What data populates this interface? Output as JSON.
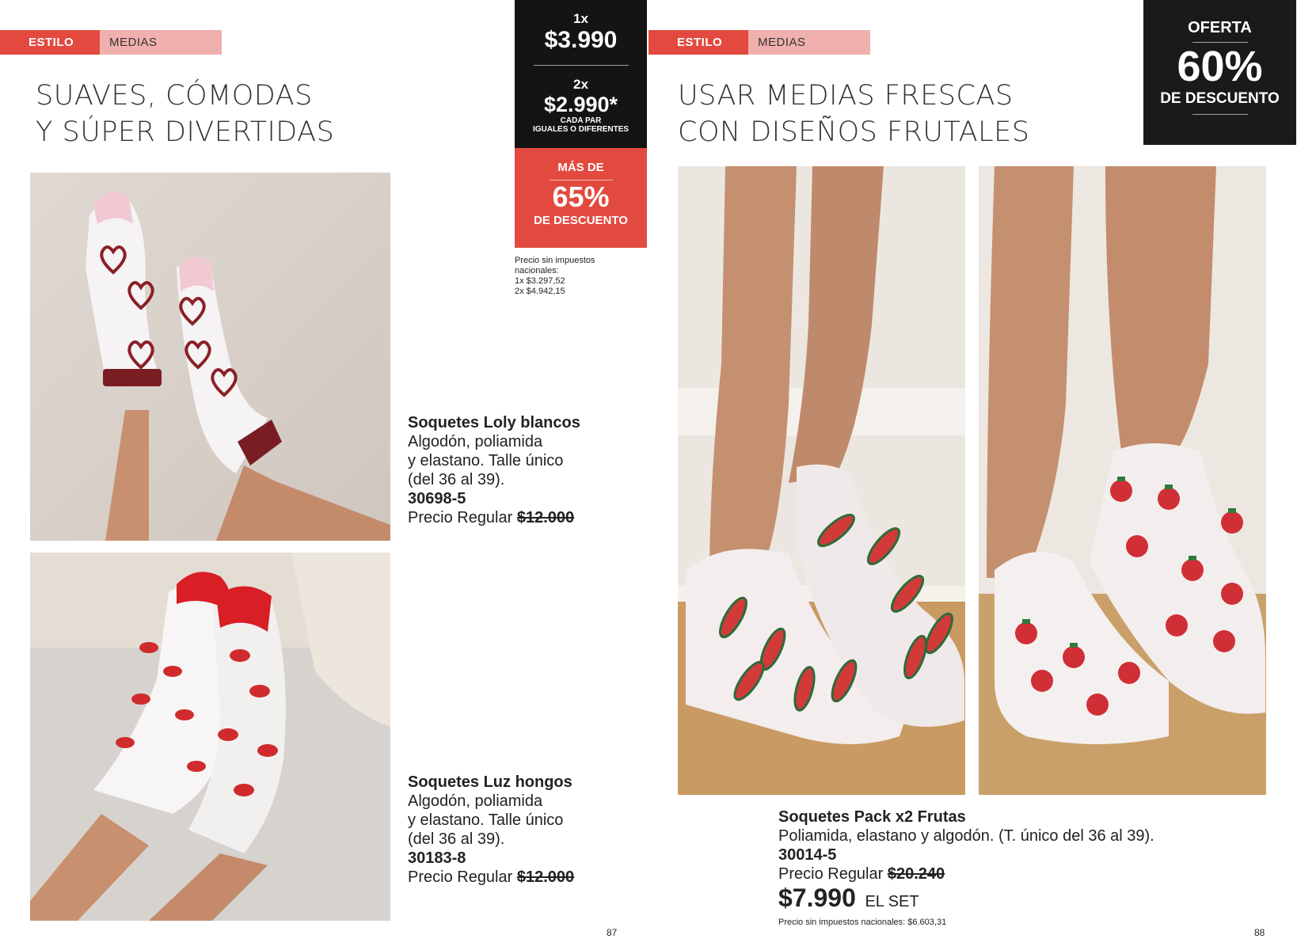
{
  "left_page": {
    "tag": {
      "section": "ESTILO",
      "category": "MEDIAS"
    },
    "headline": [
      "SUAVES, CÓMODAS",
      "Y SÚPER DIVERTIDAS"
    ],
    "products": [
      {
        "name": "Soquetes Loly blancos",
        "desc_lines": [
          "Algodón, poliamida",
          "y elastano. Talle único",
          "(del 36 al 39)."
        ],
        "code": "30698-5",
        "regular_label": "Precio Regular",
        "regular_price": "$12.000"
      },
      {
        "name": "Soquetes Luz hongos",
        "desc_lines": [
          "Algodón, poliamida",
          "y elastano. Talle único",
          "(del 36 al 39)."
        ],
        "code": "30183-8",
        "regular_label": "Precio Regular",
        "regular_price": "$12.000"
      }
    ],
    "page_number": "87"
  },
  "pricebox": {
    "one_qty": "1x",
    "one_price": "$3.990",
    "two_qty": "2x",
    "two_price": "$2.990*",
    "two_note_1": "CADA PAR",
    "two_note_2": "IGUALES O DIFERENTES",
    "discount_prefix": "MÁS DE",
    "discount_value": "65%",
    "discount_suffix": "DE DESCUENTO",
    "tax_note": [
      "Precio sin impuestos",
      "nacionales:",
      "1x $3.297,52",
      "2x $4.942,15"
    ]
  },
  "right_page": {
    "tag": {
      "section": "ESTILO",
      "category": "MEDIAS"
    },
    "headline": [
      "USAR MEDIAS FRESCAS",
      "CON DISEÑOS FRUTALES"
    ],
    "offer": {
      "label": "OFERTA",
      "value": "60%",
      "suffix": "DE DESCUENTO"
    },
    "product": {
      "name": "Soquetes Pack x2 Frutas",
      "desc": "Poliamida, elastano y algodón. (T. único del 36 al 39).",
      "code": "30014-5",
      "regular_label": "Precio Regular",
      "regular_price": "$20.240",
      "price": "$7.990",
      "price_unit": "EL SET",
      "tax_note": "Precio sin impuestos nacionales: $6.603,31"
    },
    "page_number": "88"
  },
  "colors": {
    "accent_red": "#e24a3f",
    "tag_pink": "#efb0ae",
    "dark": "#141414"
  }
}
